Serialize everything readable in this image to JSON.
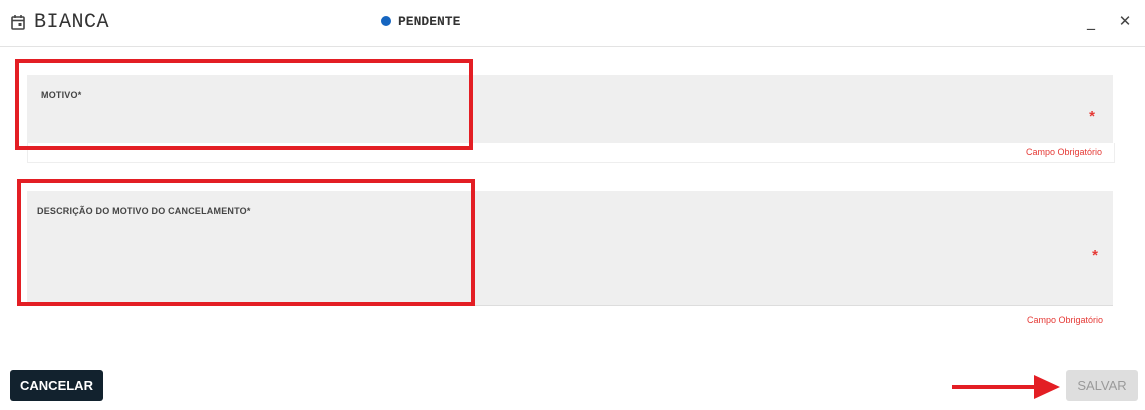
{
  "header": {
    "title": "BIANCA",
    "title_icon": "calendar-icon",
    "status": {
      "label": "PENDENTE",
      "color": "#1565c0"
    },
    "minimize_glyph": "_",
    "close_glyph": "✕"
  },
  "form": {
    "motivo": {
      "label": "MOTIVO*",
      "required_mark": "*",
      "hint": "Campo Obrigatório",
      "value": ""
    },
    "descricao": {
      "label": "DESCRIÇÃO DO MOTIVO DO CANCELAMENTO*",
      "required_mark": "*",
      "hint": "Campo Obrigatório",
      "value": ""
    }
  },
  "actions": {
    "cancel_label": "CANCELAR",
    "save_label": "SALVAR",
    "save_enabled": false
  },
  "colors": {
    "accent_dark": "#12222e",
    "error_red": "#e53935",
    "annotation_red": "#e31e24",
    "status_blue": "#1565c0"
  }
}
